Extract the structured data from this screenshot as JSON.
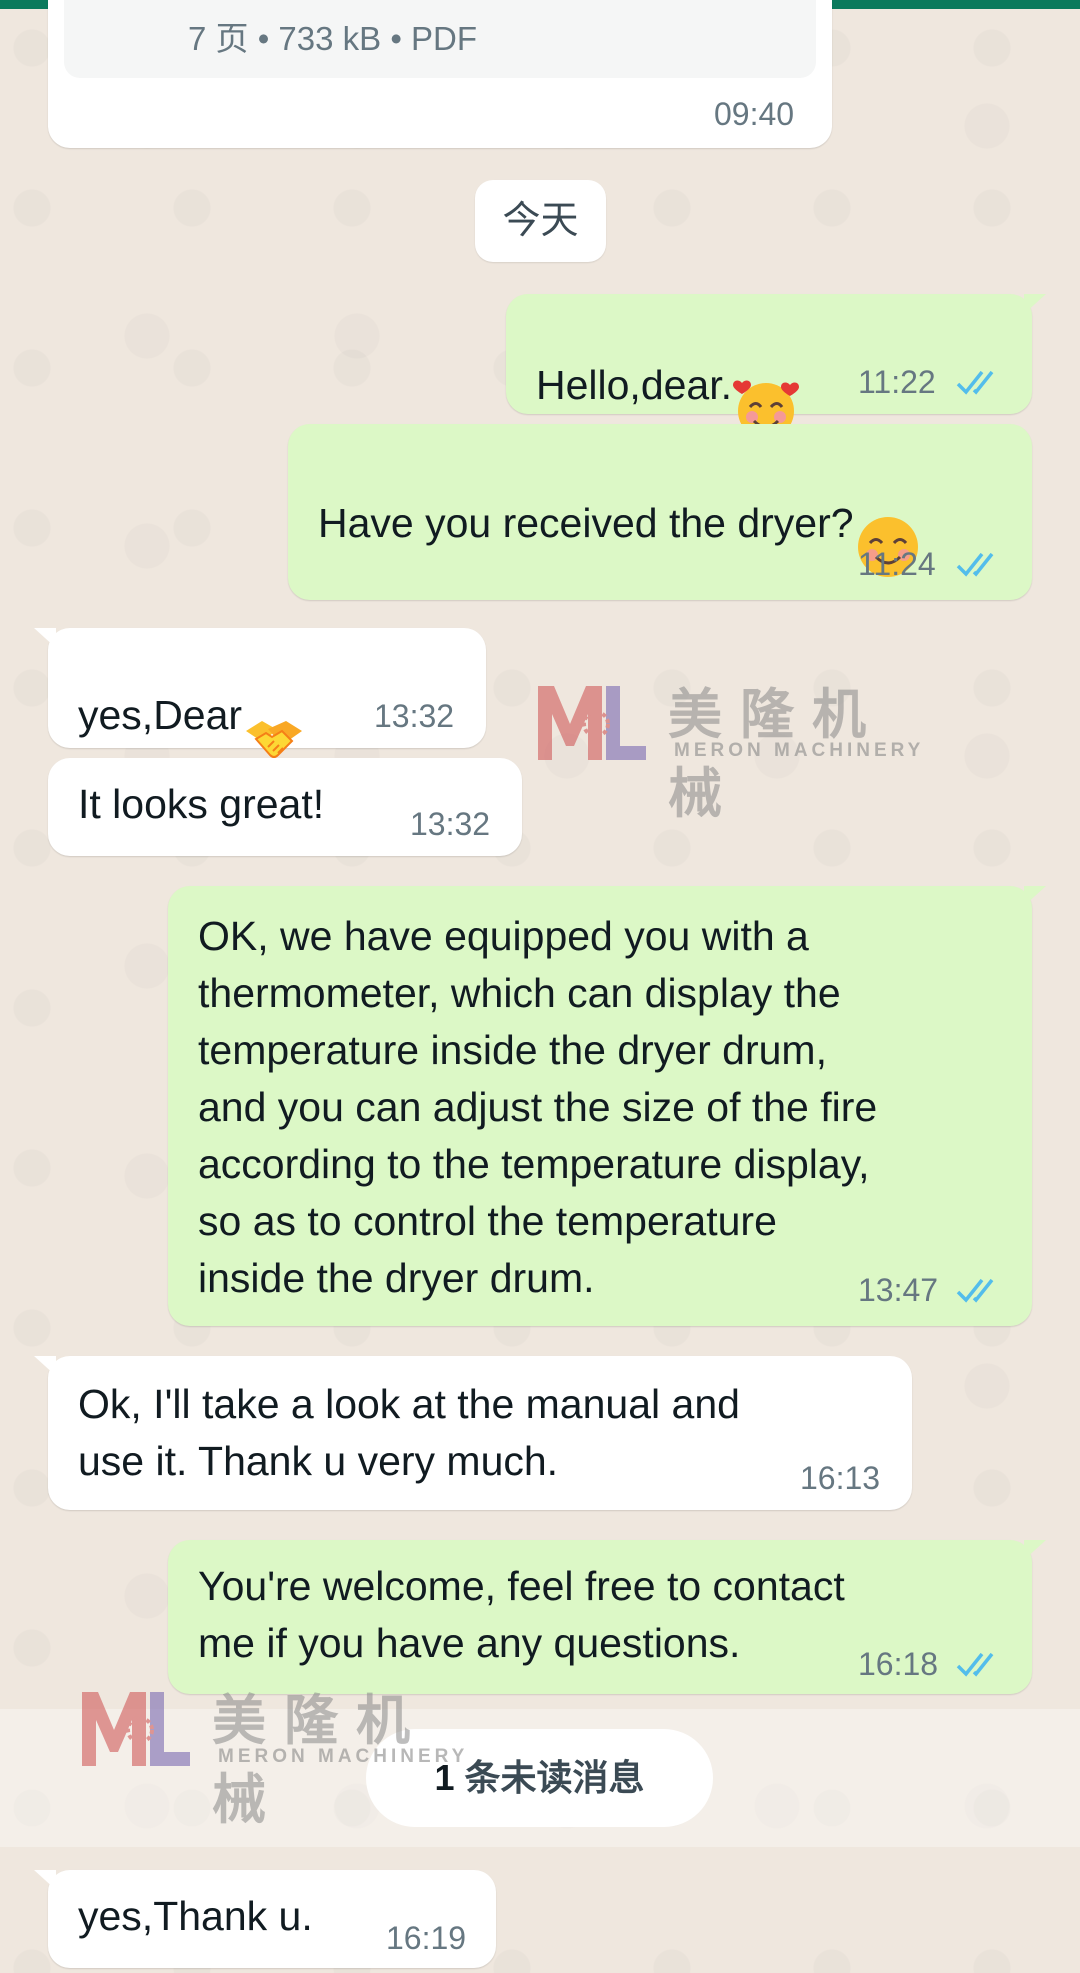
{
  "status_bar_color": "#0b7a5c",
  "colors": {
    "incoming_bubble": "#ffffff",
    "outgoing_bubble": "#dcf8c6",
    "read_ticks": "#53bdeb",
    "timestamp": "#667781"
  },
  "file_message": {
    "meta": "7 页 • 733 kB • PDF",
    "time": "09:40"
  },
  "date_divider": "今天",
  "messages": [
    {
      "direction": "outgoing",
      "text": "Hello,dear.",
      "emoji": "smiling-face-with-hearts",
      "time": "11:22",
      "status": "read"
    },
    {
      "direction": "outgoing",
      "text": "Have you received the dryer?",
      "emoji": "smiling-face-with-smiling-eyes",
      "time": "11:24",
      "status": "read"
    },
    {
      "direction": "incoming",
      "text": "yes,Dear",
      "emoji": "handshake",
      "time": "13:32"
    },
    {
      "direction": "incoming",
      "text": "It looks great!",
      "time": "13:32"
    },
    {
      "direction": "outgoing",
      "text": "OK, we have equipped you with a\nthermometer, which can display the\ntemperature inside the dryer drum,\nand you can adjust the size of the fire\naccording to the temperature display,\nso as to control the temperature\ninside the dryer drum.",
      "time": "13:47",
      "status": "read"
    },
    {
      "direction": "incoming",
      "text": "Ok, I'll take a look at the manual and\nuse it. Thank u very much.",
      "time": "16:13"
    },
    {
      "direction": "outgoing",
      "text": "You're welcome, feel free to contact\nme if you have any questions.",
      "time": "16:18",
      "status": "read"
    },
    {
      "direction": "incoming",
      "text": "yes,Thank u.",
      "time": "16:19"
    }
  ],
  "unread_divider": {
    "count": "1",
    "label": " 条未读消息"
  },
  "watermark": {
    "logo": "ML",
    "name_cn": "美隆机械",
    "name_en": "MERON MACHINERY"
  }
}
